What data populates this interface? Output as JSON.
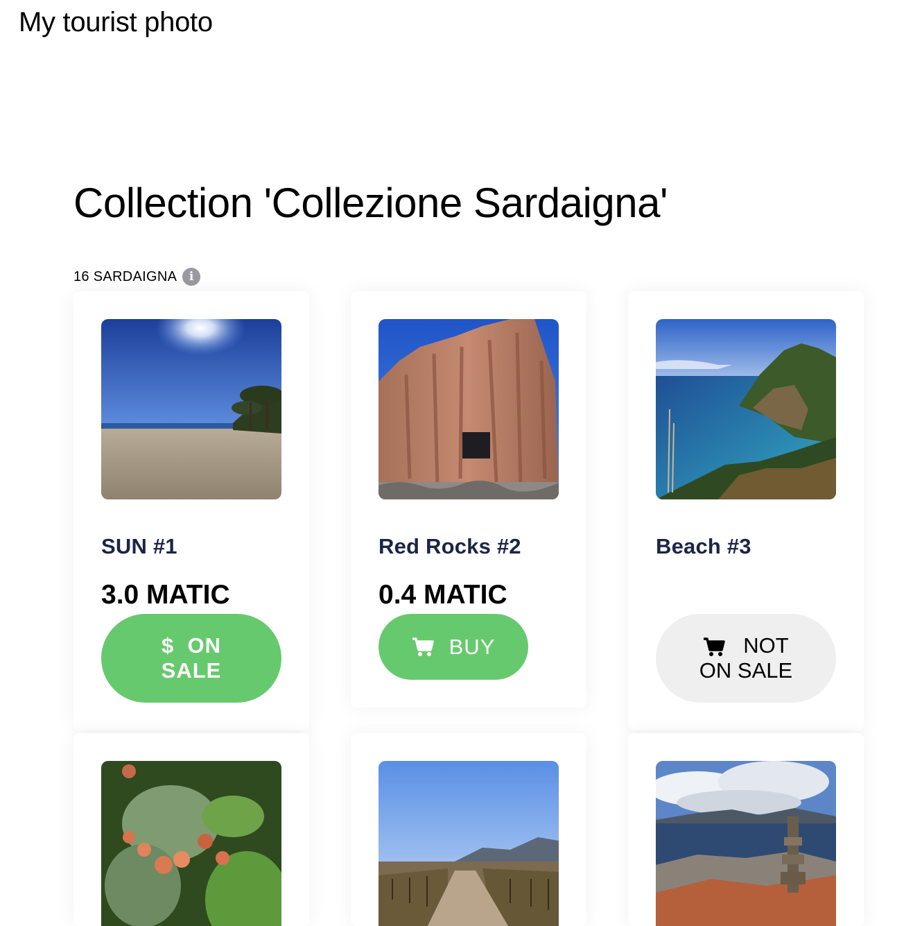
{
  "header": {
    "site_title": "My tourist photo"
  },
  "collection": {
    "title": "Collection 'Collezione Sardaigna'",
    "symbol_label": "16 SARDAIGNA",
    "info_icon": "info-icon"
  },
  "cards": [
    {
      "name": "SUN #1",
      "price": "3.0 MATIC",
      "button_icon": "$",
      "button_line1": "ON",
      "button_line2": "SALE",
      "photo": "beach with sun and pine trees"
    },
    {
      "name": "Red Rocks #2",
      "price": "0.4 MATIC",
      "button_label": "BUY",
      "button_icon": "cart-icon",
      "photo": "red rock formation with window"
    },
    {
      "name": "Beach #3",
      "price": "",
      "button_line1": "NOT",
      "button_line2": "ON SALE",
      "button_icon": "cart-icon",
      "photo": "turquoise cove with green hill"
    },
    {
      "photo": "prickly pear cactus with fruit"
    },
    {
      "photo": "vineyard rows under blue sky"
    },
    {
      "photo": "stone cairn by the sea with clouds"
    }
  ],
  "colors": {
    "accent_green": "#67c96e",
    "name_color": "#1b2447",
    "disabled_gray": "#efefef"
  }
}
